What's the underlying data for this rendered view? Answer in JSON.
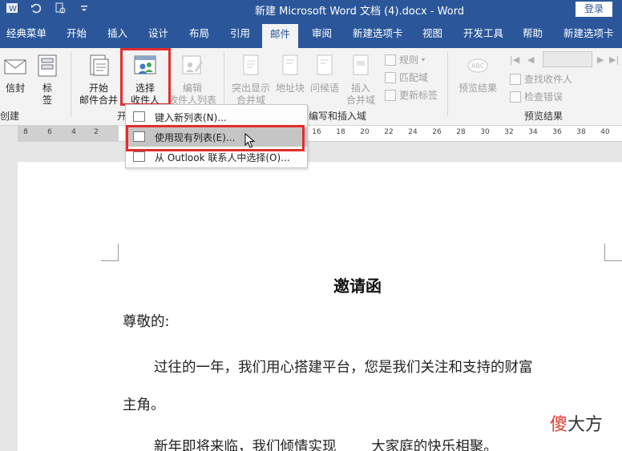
{
  "window": {
    "title": "新建 Microsoft Word 文档 (4).docx - Word",
    "login_label": "登录",
    "qat_icons": [
      "word-icon",
      "undo-icon",
      "print-preview-icon",
      "customize-qat-icon"
    ]
  },
  "tabs": [
    {
      "label": "经典菜单"
    },
    {
      "label": "开始"
    },
    {
      "label": "插入"
    },
    {
      "label": "设计"
    },
    {
      "label": "布局"
    },
    {
      "label": "引用"
    },
    {
      "label": "邮件",
      "active": true
    },
    {
      "label": "审阅"
    },
    {
      "label": "新建选项卡"
    },
    {
      "label": "视图"
    },
    {
      "label": "开发工具"
    },
    {
      "label": "帮助"
    },
    {
      "label": "新建选项卡"
    }
  ],
  "ribbon": {
    "create": {
      "envelope_label": "信封",
      "labels_label": "标",
      "labels_label2": "签",
      "group_label": "创建"
    },
    "start_merge": {
      "start_label1": "开始",
      "start_label2": "邮件合并",
      "select_label1": "选择",
      "select_label2": "收件人",
      "edit_label1": "编辑",
      "edit_label2": "收件人列表",
      "group_label": "开"
    },
    "write_insert": {
      "highlight_label1": "突出显示",
      "highlight_label2": "合并域",
      "address_label": "地址块",
      "greeting_label": "问候语",
      "insert_label1": "插入",
      "insert_label2": "合并域",
      "rules_label": "规则",
      "match_label": "匹配域",
      "update_label": "更新标签",
      "group_label": "编写和插入域"
    },
    "preview": {
      "preview_label": "预览结果",
      "find_label": "查找收件人",
      "check_label": "检查错误",
      "group_label": "预览结果"
    }
  },
  "dropdown": {
    "items": [
      {
        "label": "键入新列表(N)..."
      },
      {
        "label": "使用现有列表(E)...",
        "highlighted": true
      },
      {
        "label": "从 Outlook 联系人中选择(O)..."
      }
    ]
  },
  "ruler": {
    "ticks": [
      "8",
      "6",
      "4",
      "2",
      "2",
      "16",
      "18",
      "20",
      "22",
      "24",
      "26",
      "28",
      "30",
      "32",
      "34",
      "36",
      "38",
      "40"
    ]
  },
  "document": {
    "title": "邀请函",
    "salutation": "尊敬的:",
    "line1": "过往的一年，我们用心搭建平台，您是我们关注和支持的财富",
    "line2": "主角。",
    "line3": "新年即将来临，我们倾情实现_____大家庭的快乐相聚。",
    "watermark_red": "傻",
    "watermark_rest": "大方"
  },
  "colors": {
    "title_bar": "#2b579a",
    "ribbon_bg": "#f3f3f3",
    "highlight_border": "#e32d2d",
    "menu_highlight": "#c5c5c5"
  }
}
